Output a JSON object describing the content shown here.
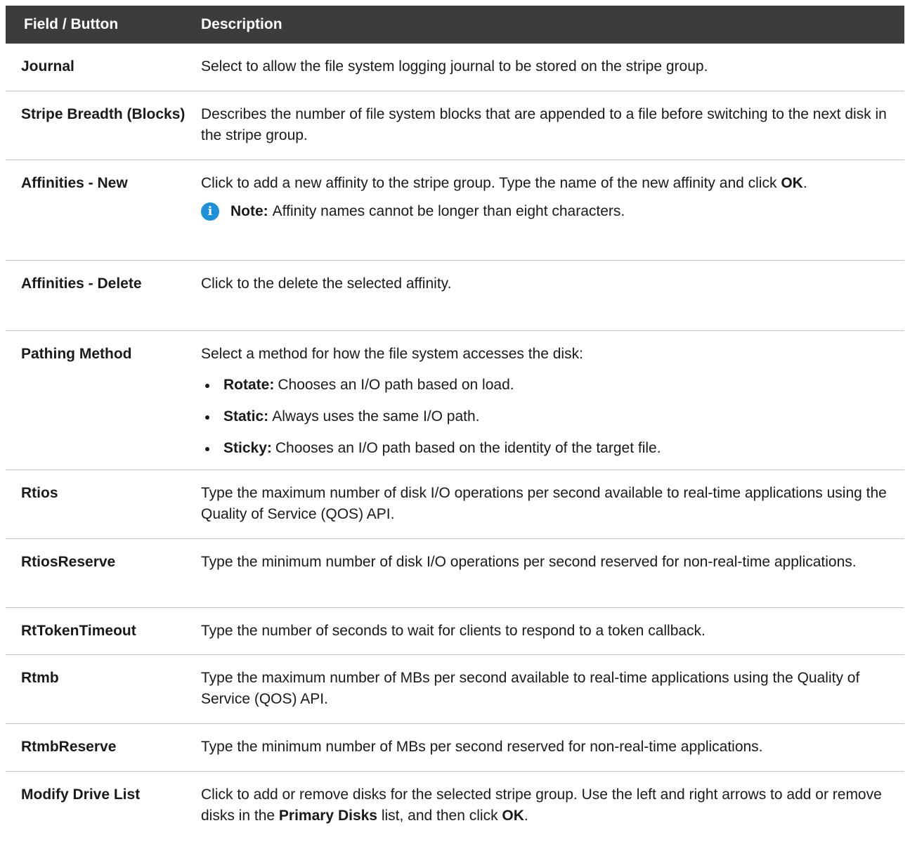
{
  "table": {
    "header": {
      "col1": "Field / Button",
      "col2": "Description"
    },
    "rows": {
      "journal": {
        "field": "Journal",
        "desc": "Select to allow the file system logging journal to be stored on the stripe group."
      },
      "stripe_breadth": {
        "field": "Stripe Breadth (Blocks)",
        "desc": "Describes the number of file system blocks that are appended to a file before switching to the next disk in the stripe group."
      },
      "affinities_new": {
        "field": "Affinities - New",
        "desc_pre": "Click to add a new affinity to the stripe group. Type the name of the new affinity and click ",
        "desc_bold": "OK",
        "desc_post": ".",
        "note_icon": "info-icon",
        "note_label": "Note:",
        "note_text": "Affinity names cannot be longer than eight characters."
      },
      "affinities_delete": {
        "field": "Affinities - Delete",
        "desc": "Click to the delete the selected affinity."
      },
      "pathing_method": {
        "field": "Pathing Method",
        "desc": "Select a method for how the file system accesses the disk:",
        "bullets": [
          {
            "label": "Rotate:",
            "text": "Chooses an I/O path based on load."
          },
          {
            "label": "Static:",
            "text": "Always uses the same I/O path."
          },
          {
            "label": "Sticky:",
            "text": "Chooses an I/O path based on the identity of the target file."
          }
        ]
      },
      "rtios": {
        "field": "Rtios",
        "desc": "Type the maximum number of disk I/O operations per second available to real-time applications using the Quality of Service (QOS) API."
      },
      "rtios_reserve": {
        "field": "RtiosReserve",
        "desc": "Type the minimum number of disk I/O operations per second reserved for non-real-time applications."
      },
      "rt_token_timeout": {
        "field": "RtTokenTimeout",
        "desc": "Type the number of seconds to wait for clients to respond to a token callback."
      },
      "rtmb": {
        "field": "Rtmb",
        "desc": "Type the maximum number of MBs per second available to real-time applications using the Quality of Service (QOS) API."
      },
      "rtmb_reserve": {
        "field": "RtmbReserve",
        "desc": "Type the minimum number of MBs per second reserved for non-real-time applications."
      },
      "modify_drive_list": {
        "field": "Modify Drive List",
        "desc_pre": "Click to add or remove disks for the selected stripe group. Use the left and right arrows to add or remove disks in the ",
        "desc_bold1": "Primary Disks",
        "desc_mid": " list, and then click ",
        "desc_bold2": "OK",
        "desc_post": "."
      }
    }
  }
}
